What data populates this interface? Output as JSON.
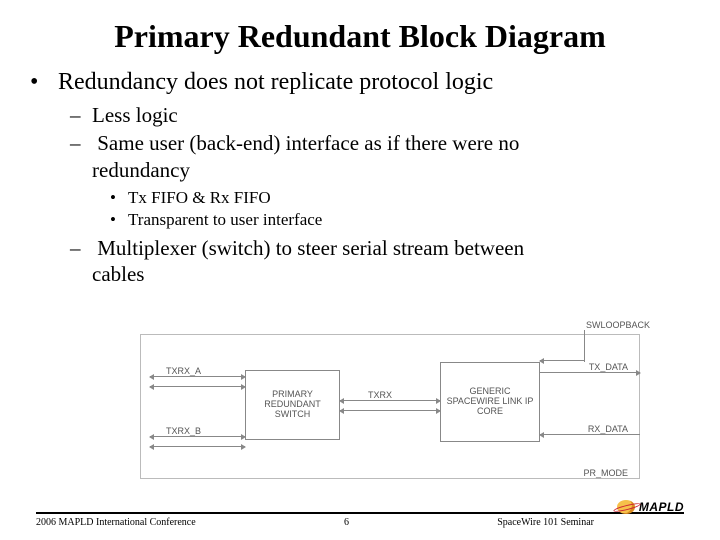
{
  "title": "Primary Redundant Block Diagram",
  "bullets": {
    "b1": "Redundancy does not replicate protocol logic",
    "b1a": "Less logic",
    "b1b_line1": "Same user (back-end) interface as if there were no",
    "b1b_line2": "redundancy",
    "b1b_i": "Tx FIFO & Rx FIFO",
    "b1b_ii": "Transparent to user interface",
    "b1c_line1": "Multiplexer (switch) to steer serial stream between",
    "b1c_line2": "cables"
  },
  "diagram": {
    "swloopback": "SWLOOPBACK",
    "txrx_a": "TXRX_A",
    "txrx_b": "TXRX_B",
    "switch": "PRIMARY REDUNDANT SWITCH",
    "txrx": "TXRX",
    "core": "GENERIC SPACEWIRE LINK IP CORE",
    "tx_data": "TX_DATA",
    "rx_data": "RX_DATA",
    "pr_mode": "PR_MODE"
  },
  "footer": {
    "left": "2006 MAPLD International Conference",
    "center": "6",
    "right": "SpaceWire 101 Seminar",
    "logo": "MAPLD"
  }
}
